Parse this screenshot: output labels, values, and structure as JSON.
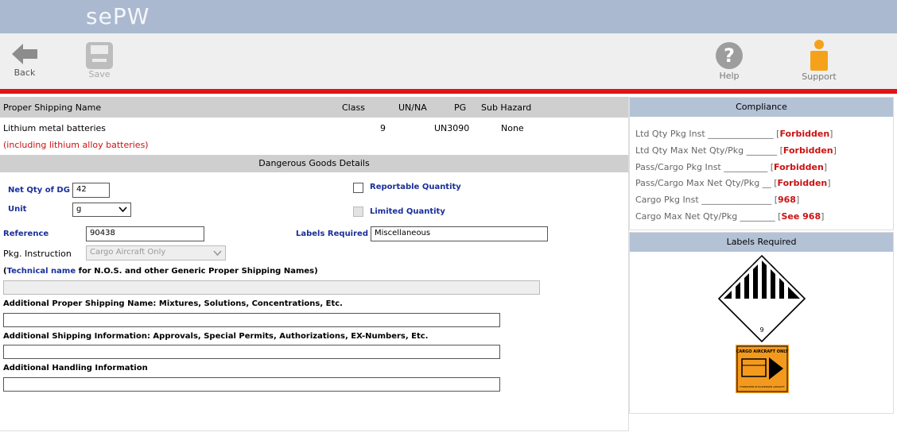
{
  "app": {
    "logo": "sePW"
  },
  "toolbar": {
    "back_label": "Back",
    "save_label": "Save",
    "help_label": "Help",
    "support_label": "Support"
  },
  "table": {
    "headers": {
      "name": "Proper Shipping Name",
      "class": "Class",
      "unna": "UN/NA",
      "pg": "PG",
      "sub": "Sub Hazard"
    },
    "row": {
      "name": "Lithium metal batteries",
      "note": "(including lithium alloy batteries)",
      "class": "9",
      "unna": "UN3090",
      "sub": "None"
    }
  },
  "details": {
    "section_title": "Dangerous Goods Details",
    "net_qty_label": "Net Qty of DG",
    "net_qty_value": "42",
    "unit_label": "Unit",
    "unit_value": "g",
    "reportable_label": "Reportable Quantity",
    "limited_label": "Limited Quantity",
    "reference_label": "Reference",
    "reference_value": "90438",
    "labels_required_label": "Labels Required",
    "labels_required_value": "Miscellaneous",
    "pkg_instruction_label": "Pkg. Instruction",
    "pkg_instruction_value": "Cargo Aircraft Only",
    "technical_open": "(",
    "technical_link": "Technical name",
    "technical_rest": " for N.O.S. and other Generic Proper Shipping Names)",
    "add_psn_label": "Additional Proper Shipping Name: Mixtures, Solutions, Concentrations, Etc.",
    "add_ship_label": "Additional Shipping Information: Approvals, Special Permits, Authorizations, EX-Numbers, Etc.",
    "add_handling_label": "Additional Handling Information"
  },
  "compliance": {
    "title": "Compliance",
    "lines": [
      {
        "label": "Ltd Qty Pkg Inst _______________ ",
        "value": "Forbidden"
      },
      {
        "label": "Ltd Qty Max Net Qty/Pkg _______ ",
        "value": "Forbidden"
      },
      {
        "label": "Pass/Cargo Pkg Inst __________ ",
        "value": "Forbidden"
      },
      {
        "label": "Pass/Cargo Max Net Qty/Pkg __ ",
        "value": "Forbidden"
      },
      {
        "label": "Cargo Pkg Inst ________________ ",
        "value": "968"
      },
      {
        "label": "Cargo Max Net Qty/Pkg ________ ",
        "value": "See 968"
      }
    ]
  },
  "labels_panel": {
    "title": "Labels Required",
    "class9_number": "9",
    "cao_title": "CARGO AIRCRAFT ONLY",
    "cao_sub": "FORBIDDEN IN PASSENGER AIRCRAFT"
  },
  "colors": {
    "topbar": "#aab9cf",
    "redline": "#e31414",
    "link_blue": "#1a2f9a",
    "forbidden_red": "#cc1111",
    "support_orange": "#f5a21a"
  }
}
